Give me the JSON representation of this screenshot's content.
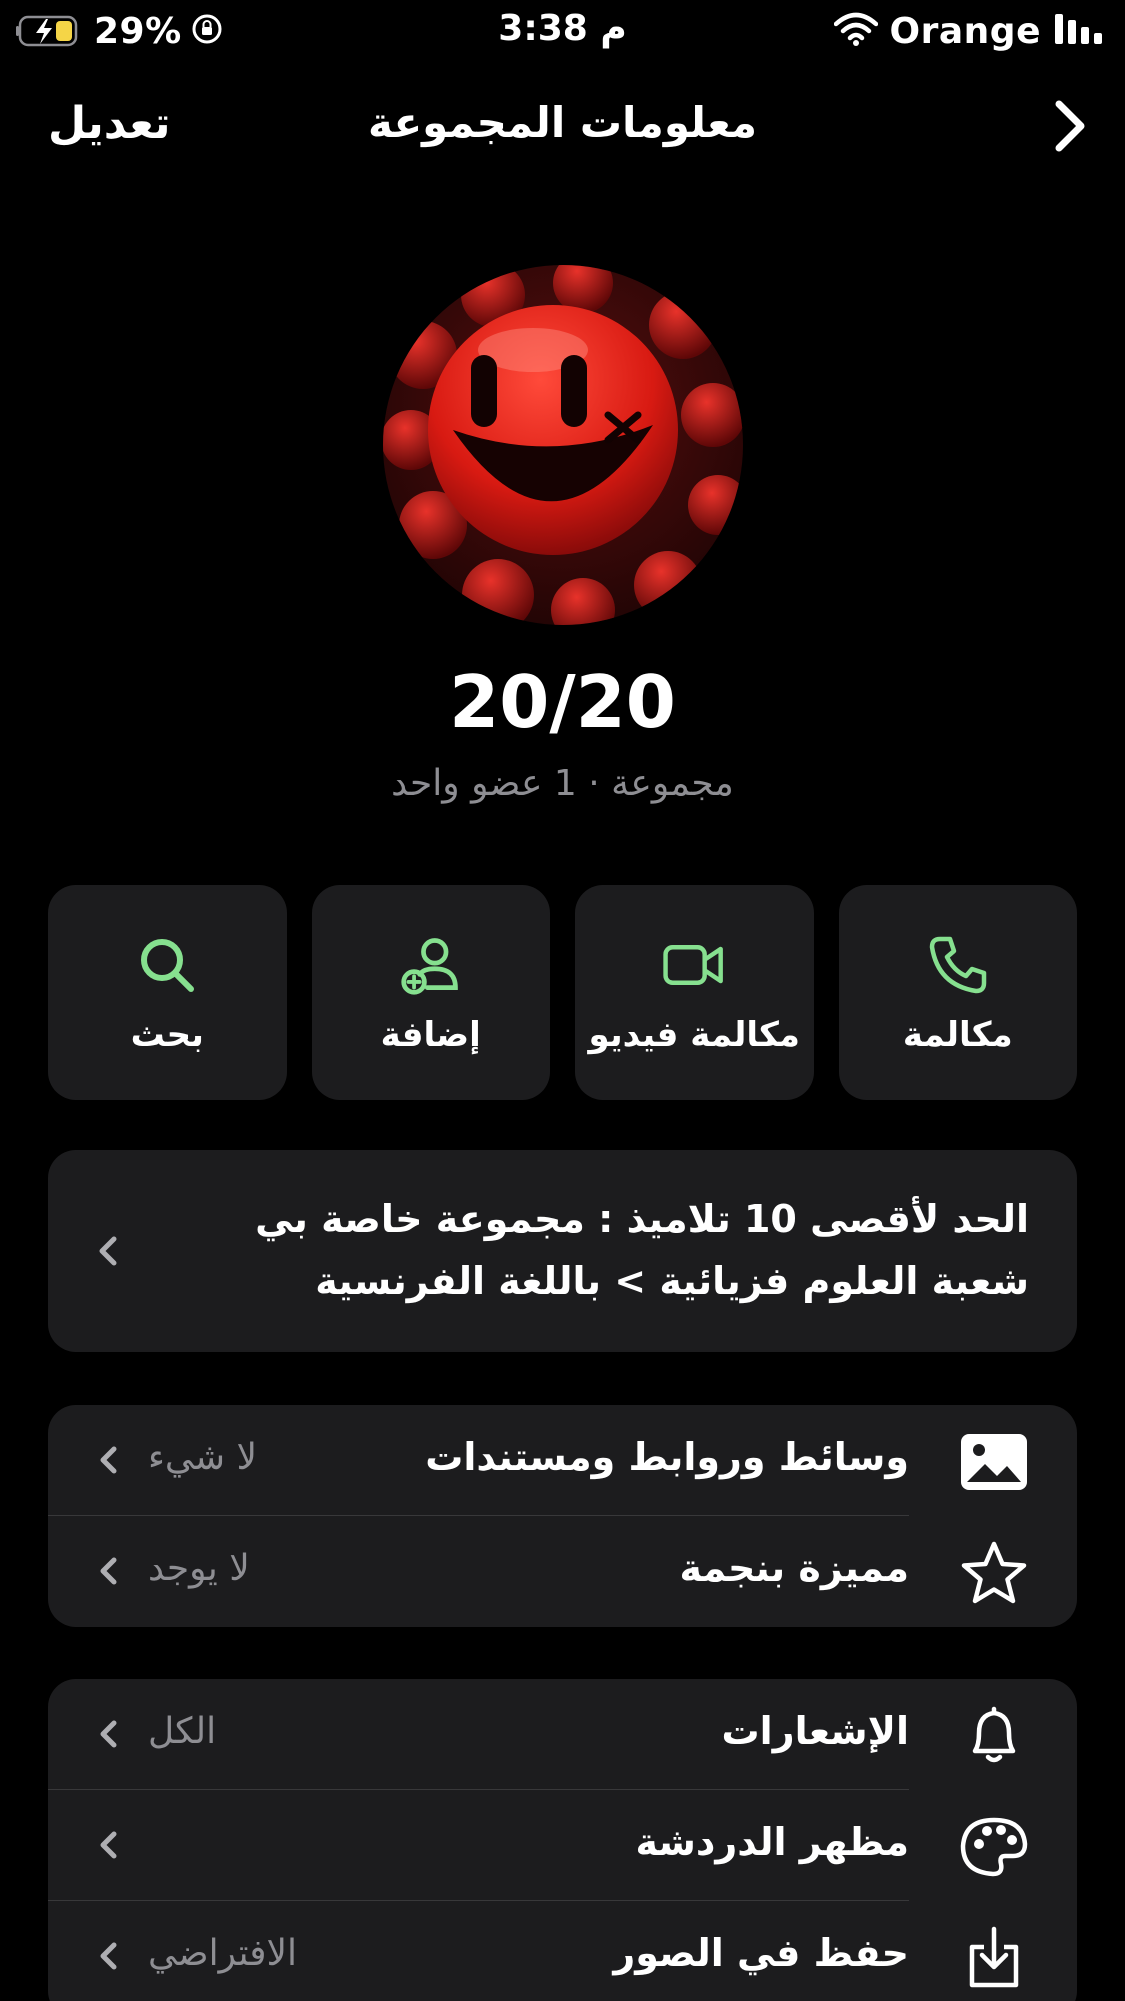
{
  "status_bar": {
    "battery_percent": "29%",
    "time": "3:38 م",
    "carrier": "Orange"
  },
  "nav": {
    "edit_label": "تعديل",
    "title": "معلومات المجموعة"
  },
  "group": {
    "name": "20/20",
    "subtitle": "مجموعة · 1 عضو واحد"
  },
  "actions": [
    {
      "label": "بحث",
      "icon": "search-icon"
    },
    {
      "label": "إضافة",
      "icon": "add-user-icon"
    },
    {
      "label": "مكالمة فيديو",
      "icon": "video-icon"
    },
    {
      "label": "مكالمة",
      "icon": "phone-icon"
    }
  ],
  "description": {
    "text": "الحد لأقصى 10 تلاميذ : مجموعة خاصة بي شعبة العلوم فزيائية > باللغة الفرنسية"
  },
  "media_section": [
    {
      "label": "وسائط وروابط ومستندات",
      "value": "لا شيء",
      "icon": "photo-icon"
    },
    {
      "label": "مميزة بنجمة",
      "value": "لا يوجد",
      "icon": "star-icon"
    }
  ],
  "settings_section": [
    {
      "label": "الإشعارات",
      "value": "الكل",
      "icon": "bell-icon"
    },
    {
      "label": "مظهر الدردشة",
      "value": "",
      "icon": "palette-icon"
    },
    {
      "label": "حفظ في الصور",
      "value": "الافتراضي",
      "icon": "save-download-icon"
    }
  ],
  "colors": {
    "accent_green": "#86e08f",
    "card_bg": "#1c1c1e",
    "secondary_text": "#8e8e93"
  }
}
